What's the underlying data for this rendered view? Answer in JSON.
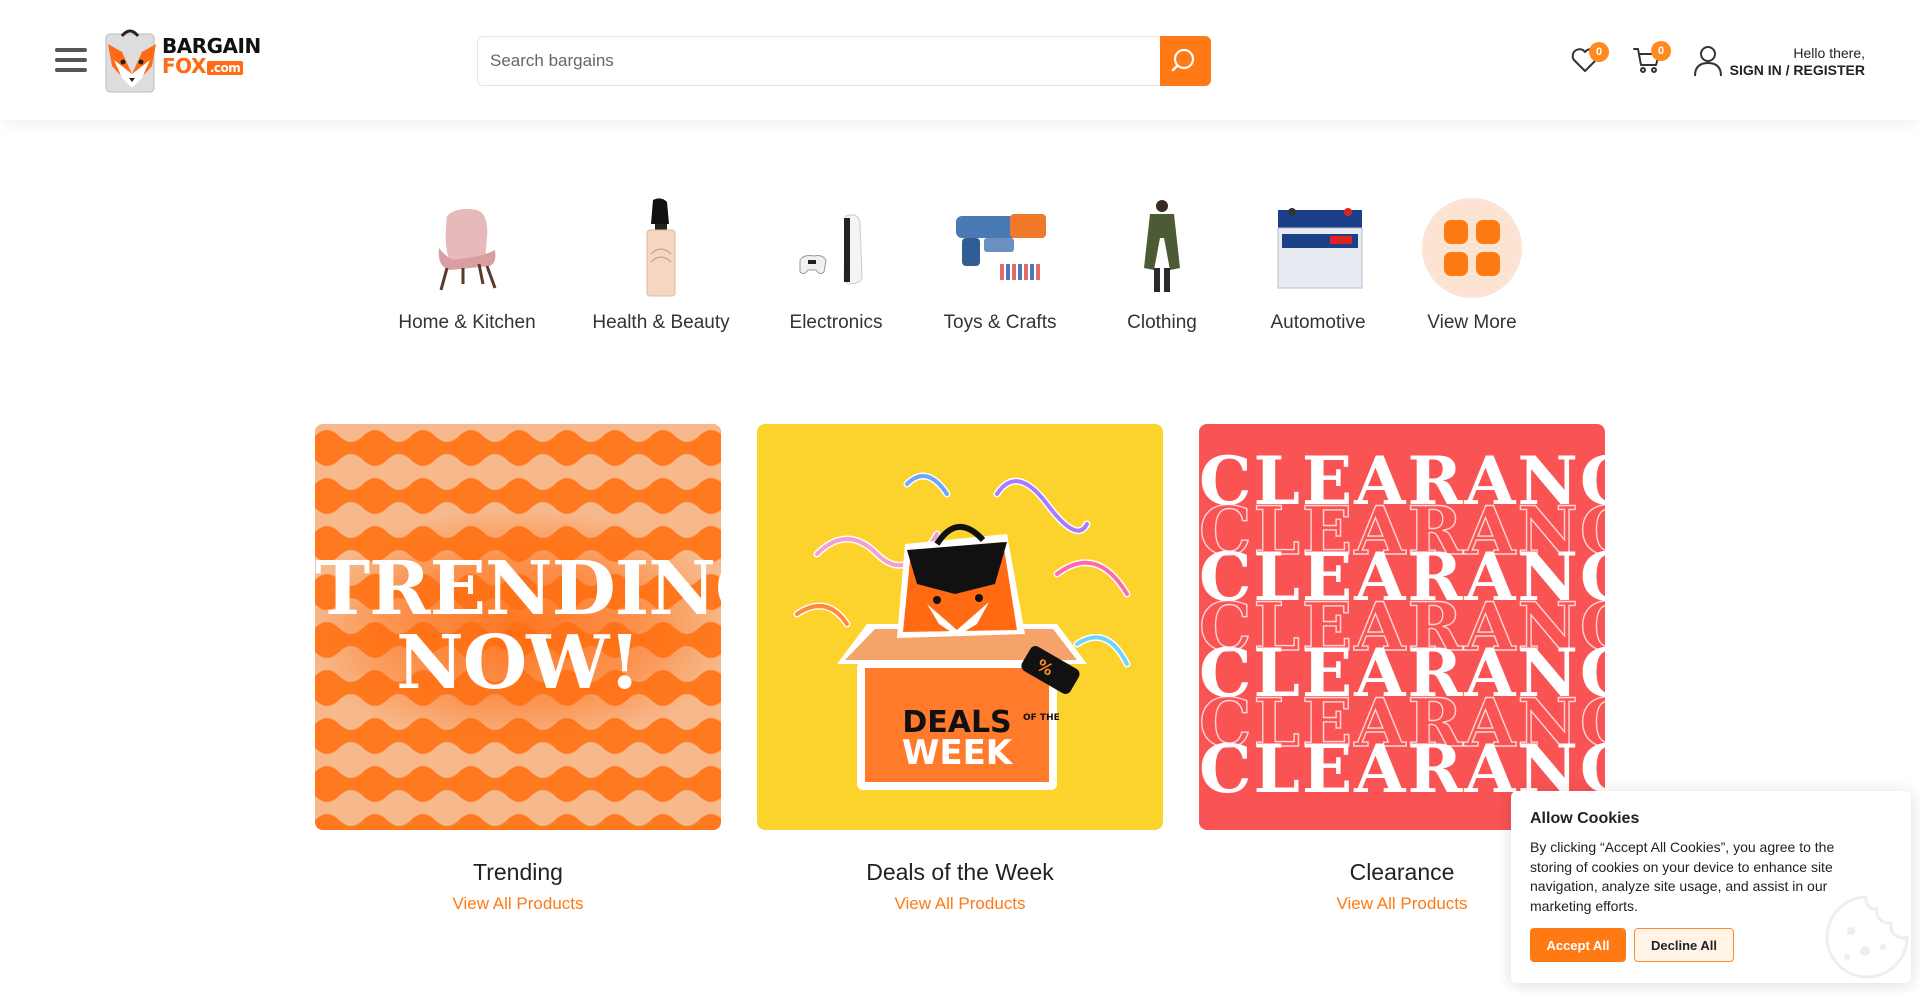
{
  "header": {
    "logo": {
      "line1": "BARGAIN",
      "line2": "FOX",
      "line3": ".com"
    },
    "search": {
      "placeholder": "Search bargains",
      "value": ""
    },
    "wishlist": {
      "count": "0"
    },
    "cart": {
      "count": "0"
    },
    "account": {
      "greeting": "Hello there,",
      "signin": "SIGN IN / REGISTER"
    },
    "icons": [
      "menu-icon",
      "search-icon",
      "heart-icon",
      "cart-icon",
      "user-icon"
    ]
  },
  "categories": [
    {
      "label": "Home & Kitchen",
      "icon": "armchair-image"
    },
    {
      "label": "Health & Beauty",
      "icon": "perfume-image"
    },
    {
      "label": "Electronics",
      "icon": "console-image"
    },
    {
      "label": "Toys & Crafts",
      "icon": "toy-blaster-image"
    },
    {
      "label": "Clothing",
      "icon": "coat-image"
    },
    {
      "label": "Automotive",
      "icon": "car-battery-image"
    },
    {
      "label": "View More",
      "icon": "grid-icon"
    }
  ],
  "promos": [
    {
      "title": "Trending",
      "link": "View All Products",
      "art_text": [
        "TRENDING",
        "NOW!"
      ]
    },
    {
      "title": "Deals of the Week",
      "link": "View All Products",
      "art_text": [
        "DEALS",
        "OF THE",
        "WEEK",
        "%"
      ]
    },
    {
      "title": "Clearance",
      "link": "View All Products",
      "art_text": [
        "CLEARANCE"
      ]
    }
  ],
  "cookie": {
    "title": "Allow Cookies",
    "text": "By clicking “Accept All Cookies”, you agree to the storing of cookies on your device to enhance site navigation, analyze site usage, and assist in our marketing efforts.",
    "accept": "Accept All",
    "decline": "Decline All"
  },
  "colors": {
    "accent": "#ff7a14",
    "trending": "#ff7a1f",
    "deals": "#fcd22c",
    "clearance": "#f95354"
  }
}
